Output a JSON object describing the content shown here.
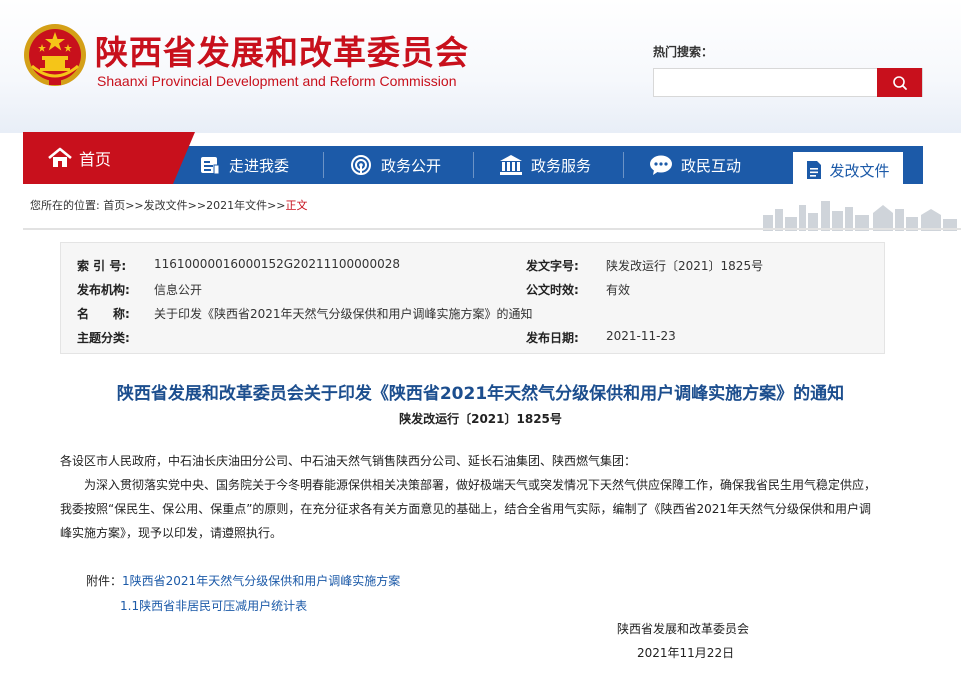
{
  "header": {
    "title": "陕西省发展和改革委员会",
    "subtitle": "Shaanxi Provincial Development and Reform Commission",
    "hot_search_label": "热门搜索：",
    "search_placeholder": ""
  },
  "nav": {
    "home": "首页",
    "items": [
      "走进我委",
      "政务公开",
      "政务服务",
      "政民互动"
    ],
    "active": "发改文件"
  },
  "breadcrumb": {
    "prefix": "您所在的位置:",
    "items": [
      "首页",
      "发改文件",
      "2021年文件",
      "正文"
    ],
    "separator": ">>"
  },
  "meta": {
    "index_no_label": "索 引 号:",
    "index_no": "11610000016000152G20211100000028",
    "doc_no_label": "发文字号:",
    "doc_no": "陕发改运行〔2021〕1825号",
    "org_label": "发布机构:",
    "org": "信息公开",
    "validity_label": "公文时效:",
    "validity": "有效",
    "name_label": "名　　称:",
    "name": "关于印发《陕西省2021年天然气分级保供和用户调峰实施方案》的通知",
    "topic_label": "主题分类:",
    "topic": "",
    "date_label": "发布日期:",
    "date": "2021-11-23"
  },
  "document": {
    "title": "陕西省发展和改革委员会关于印发《陕西省2021年天然气分级保供和用户调峰实施方案》的通知",
    "number": "陕发改运行〔2021〕1825号",
    "addressee": "各设区市人民政府，中石油长庆油田分公司、中石油天然气销售陕西分公司、延长石油集团、陕西燃气集团：",
    "para1_line1": "为深入贯彻落实党中央、国务院关于今冬明春能源保供相关决策部署，做好极端天气或突发情况下天然气供应保障工作，确保我省民生用气稳定供应，",
    "para1_line2": "我委按照“保民生、保公用、保重点”的原则，在充分征求各有关方面意见的基础上，结合全省用气实际，编制了《陕西省2021年天然气分级保供和用户调",
    "para1_line3": "峰实施方案》，现予以印发，请遵照执行。",
    "attach_label": "附件：",
    "attachments": [
      "1陕西省2021年天然气分级保供和用户调峰实施方案",
      "1.1陕西省非居民可压减用户统计表"
    ],
    "signer": "陕西省发展和改革委员会",
    "sign_date": "2021年11月22日"
  }
}
